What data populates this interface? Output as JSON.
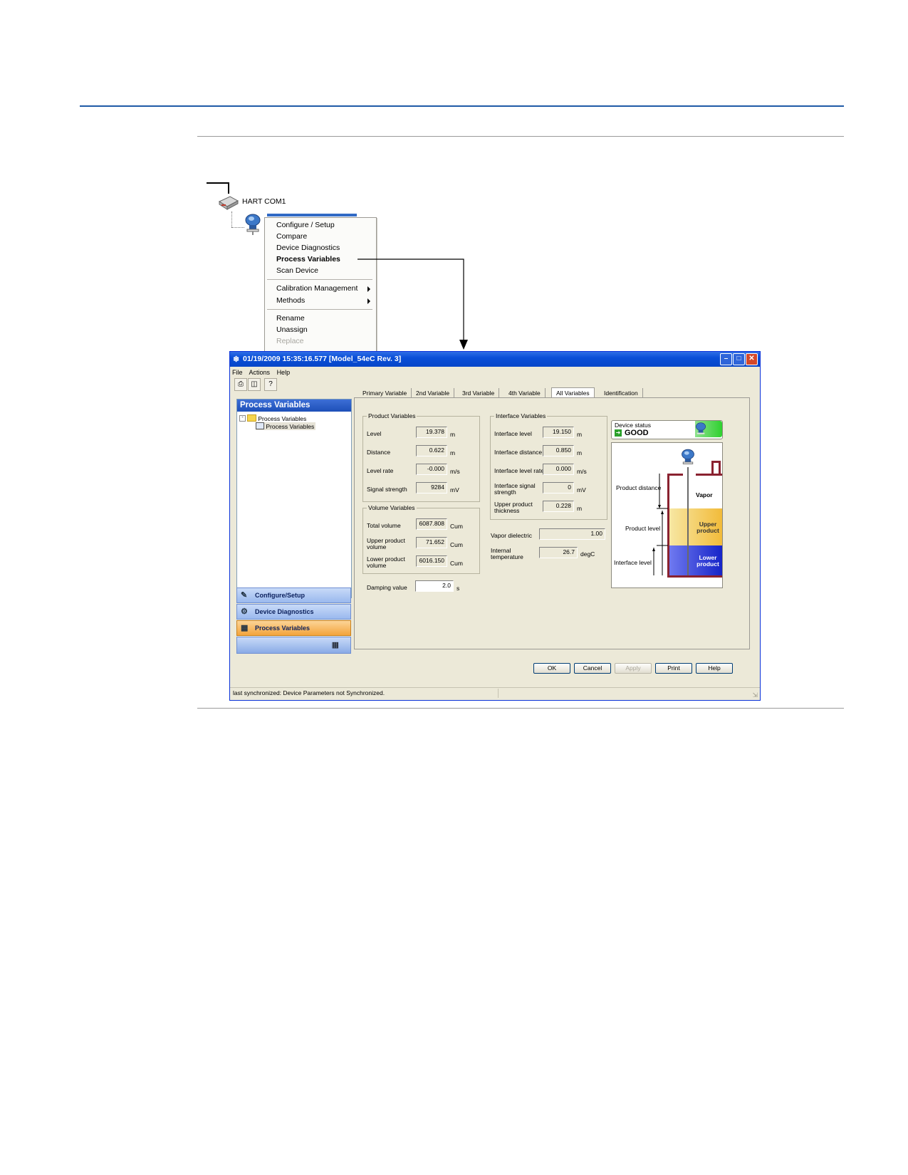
{
  "tree": {
    "hart_label": "HART COM1"
  },
  "context_menu": {
    "items": [
      {
        "label": "Configure / Setup",
        "bold": false,
        "disabled": false
      },
      {
        "label": "Compare",
        "bold": false,
        "disabled": false
      },
      {
        "label": "Device Diagnostics",
        "bold": false,
        "disabled": false
      },
      {
        "label": "Process Variables",
        "bold": true,
        "disabled": false
      },
      {
        "label": "Scan Device",
        "bold": false,
        "disabled": false
      },
      {
        "label": "Calibration Management",
        "bold": false,
        "disabled": false
      },
      {
        "label": "Methods",
        "bold": false,
        "disabled": false
      },
      {
        "label": "Rename",
        "bold": false,
        "disabled": false
      },
      {
        "label": "Unassign",
        "bold": false,
        "disabled": false
      },
      {
        "label": "Replace",
        "bold": false,
        "disabled": true
      }
    ]
  },
  "window": {
    "title": "01/19/2009 15:35:16.577 [Model_54eC Rev. 3]",
    "menu": [
      "File",
      "Actions",
      "Help"
    ],
    "status_bar": "last synchronized: Device Parameters not Synchronized."
  },
  "left_panel": {
    "title": "Process Variables",
    "tree_root": "Process Variables",
    "tree_child": "Process Variables",
    "nav": [
      "Configure/Setup",
      "Device Diagnostics",
      "Process Variables"
    ]
  },
  "tabs": [
    "Primary Variable",
    "2nd Variable",
    "3rd Variable",
    "4th Variable",
    "All Variables",
    "Identification"
  ],
  "active_tab": "All Variables",
  "product_variables": {
    "title": "Product Variables",
    "rows": [
      {
        "label": "Level",
        "value": "19.378",
        "unit": "m"
      },
      {
        "label": "Distance",
        "value": "0.622",
        "unit": "m"
      },
      {
        "label": "Level rate",
        "value": "-0.000",
        "unit": "m/s"
      },
      {
        "label": "Signal strength",
        "value": "9284",
        "unit": "mV"
      }
    ]
  },
  "volume_variables": {
    "title": "Volume Variables",
    "rows": [
      {
        "label": "Total volume",
        "value": "6087.808",
        "unit": "Cum"
      },
      {
        "label": "Upper product volume",
        "value": "71.652",
        "unit": "Cum"
      },
      {
        "label": "Lower product volume",
        "value": "6016.150",
        "unit": "Cum"
      }
    ]
  },
  "interface_variables": {
    "title": "Interface Variables",
    "rows": [
      {
        "label": "Interface level",
        "value": "19.150",
        "unit": "m"
      },
      {
        "label": "Interface distance",
        "value": "0.850",
        "unit": "m"
      },
      {
        "label": "Interface level rate",
        "value": "0.000",
        "unit": "m/s"
      },
      {
        "label": "Interface signal strength",
        "value": "0",
        "unit": "mV"
      },
      {
        "label": "Upper product thickness",
        "value": "0.228",
        "unit": "m"
      }
    ]
  },
  "vapor_dielectric": {
    "label": "Vapor dielectric",
    "value": "1.00"
  },
  "internal_temperature": {
    "label": "Internal temperature",
    "value": "26.7",
    "unit": "degC"
  },
  "damping": {
    "label": "Damping value",
    "value": "2.0",
    "unit": "s"
  },
  "device_status": {
    "title": "Device status",
    "value": "GOOD"
  },
  "diagram": {
    "product_distance": "Product distance",
    "product_level": "Product level",
    "interface_level": "Interface level",
    "vapor": "Vapor",
    "upper_product": "Upper product",
    "lower_product": "Lower product",
    "colors": {
      "upper": "#f4c24a",
      "lower": "#2233d6",
      "tank": "#8a2230"
    }
  },
  "buttons": {
    "ok": "OK",
    "cancel": "Cancel",
    "apply": "Apply",
    "print": "Print",
    "help": "Help"
  }
}
